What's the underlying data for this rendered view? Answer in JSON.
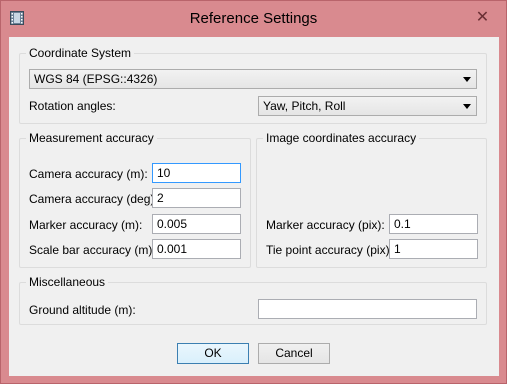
{
  "window": {
    "title": "Reference Settings"
  },
  "coordinate_system": {
    "group_title": "Coordinate System",
    "crs_value": "WGS 84 (EPSG::4326)",
    "rotation_label": "Rotation angles:",
    "rotation_value": "Yaw, Pitch, Roll"
  },
  "measurement_accuracy": {
    "group_title": "Measurement accuracy",
    "camera_m_label": "Camera accuracy (m):",
    "camera_m_value": "10",
    "camera_deg_label": "Camera accuracy (deg):",
    "camera_deg_value": "2",
    "marker_m_label": "Marker accuracy (m):",
    "marker_m_value": "0.005",
    "scalebar_m_label": "Scale bar accuracy (m):",
    "scalebar_m_value": "0.001"
  },
  "image_accuracy": {
    "group_title": "Image coordinates accuracy",
    "marker_pix_label": "Marker accuracy (pix):",
    "marker_pix_value": "0.1",
    "tiepoint_pix_label": "Tie point accuracy (pix):",
    "tiepoint_pix_value": "1"
  },
  "miscellaneous": {
    "group_title": "Miscellaneous",
    "ground_altitude_label": "Ground altitude (m):",
    "ground_altitude_value": ""
  },
  "buttons": {
    "ok": "OK",
    "cancel": "Cancel"
  }
}
